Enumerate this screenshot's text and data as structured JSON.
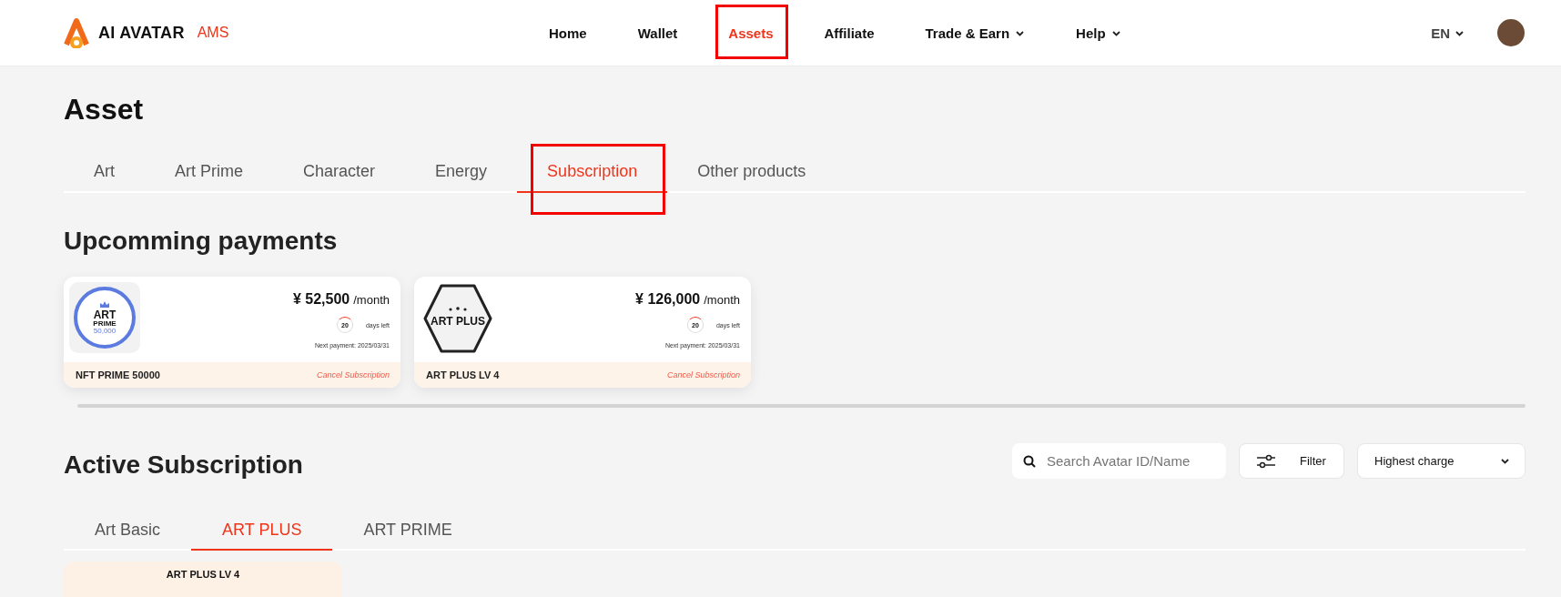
{
  "header": {
    "logo_text": "AI AVATAR",
    "logo_suffix": "AMS",
    "nav": [
      {
        "label": "Home",
        "selected": false,
        "dropdown": false,
        "highlighted": false
      },
      {
        "label": "Wallet",
        "selected": false,
        "dropdown": false,
        "highlighted": false
      },
      {
        "label": "Assets",
        "selected": true,
        "dropdown": false,
        "highlighted": true
      },
      {
        "label": "Affiliate",
        "selected": false,
        "dropdown": false,
        "highlighted": false
      },
      {
        "label": "Trade & Earn",
        "selected": false,
        "dropdown": true,
        "highlighted": false
      },
      {
        "label": "Help",
        "selected": false,
        "dropdown": true,
        "highlighted": false
      }
    ],
    "language": "EN"
  },
  "page_title": "Asset",
  "tabs": [
    {
      "label": "Art",
      "selected": false,
      "highlighted": false
    },
    {
      "label": "Art Prime",
      "selected": false,
      "highlighted": false
    },
    {
      "label": "Character",
      "selected": false,
      "highlighted": false
    },
    {
      "label": "Energy",
      "selected": false,
      "highlighted": false
    },
    {
      "label": "Subscription",
      "selected": true,
      "highlighted": true
    },
    {
      "label": "Other products",
      "selected": false,
      "highlighted": false
    }
  ],
  "upcoming": {
    "title": "Upcomming payments",
    "cards": [
      {
        "kind": "prime",
        "badge_lines": [
          "ART",
          "PRIME",
          "50,000"
        ],
        "price": "¥ 52,500",
        "period": "/month",
        "days": "20",
        "days_label": "days left",
        "next_payment": "Next payment: 2025/03/31",
        "name": "NFT PRIME 50000",
        "cancel": "Cancel Subscription"
      },
      {
        "kind": "plus",
        "badge_lines": [
          "ART PLUS"
        ],
        "price": "¥ 126,000",
        "period": "/month",
        "days": "20",
        "days_label": "days left",
        "next_payment": "Next payment: 2025/03/31",
        "name": "ART PLUS LV 4",
        "cancel": "Cancel Subscription"
      }
    ]
  },
  "active": {
    "title": "Active Subscription",
    "search": {
      "placeholder": "Search Avatar ID/Name"
    },
    "filter": "Filter",
    "sort": "Highest charge",
    "tabs": [
      {
        "label": "Art Basic",
        "selected": false
      },
      {
        "label": "ART PLUS",
        "selected": true
      },
      {
        "label": "ART PRIME",
        "selected": false
      }
    ],
    "cards": [
      {
        "name": "ART PLUS LV 4"
      }
    ]
  }
}
